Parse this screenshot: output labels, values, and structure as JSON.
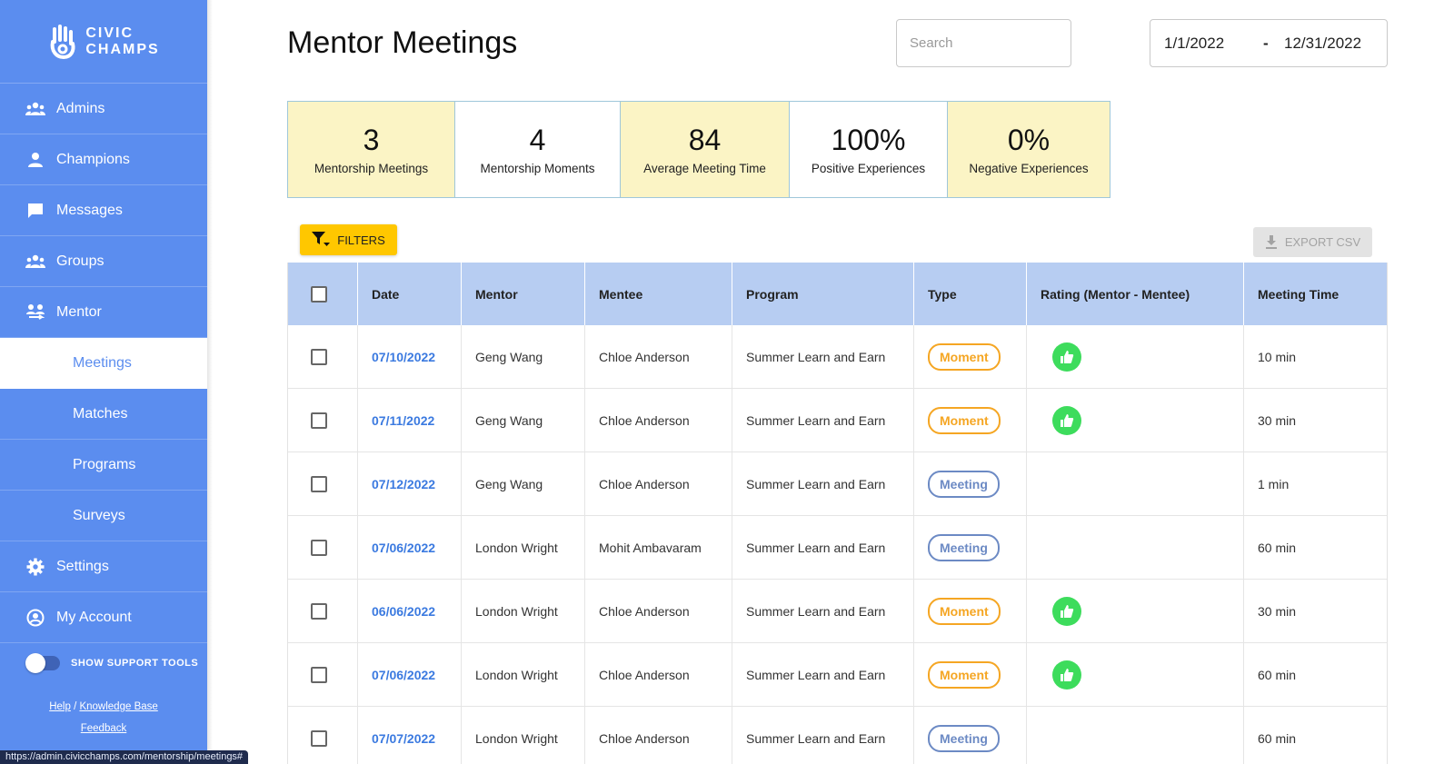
{
  "brand": {
    "line1": "CIVIC",
    "line2": "CHAMPS"
  },
  "sidebar": {
    "items": [
      {
        "label": "Admins",
        "icon": "group-icon"
      },
      {
        "label": "Champions",
        "icon": "person-icon"
      },
      {
        "label": "Messages",
        "icon": "chat-icon"
      },
      {
        "label": "Groups",
        "icon": "group-icon"
      },
      {
        "label": "Mentor",
        "icon": "mentor-icon"
      }
    ],
    "sub_items": [
      {
        "label": "Meetings",
        "active": true
      },
      {
        "label": "Matches"
      },
      {
        "label": "Programs"
      },
      {
        "label": "Surveys"
      }
    ],
    "bottom_items": [
      {
        "label": "Settings",
        "icon": "gear-icon"
      },
      {
        "label": "My Account",
        "icon": "account-icon"
      }
    ],
    "support_label": "SHOW SUPPORT TOOLS",
    "help_label": "Help",
    "slash": "/",
    "kb_label": "Knowledge Base",
    "feedback_label": "Feedback"
  },
  "status_url": "https://admin.civicchamps.com/mentorship/meetings#",
  "header": {
    "title": "Mentor Meetings",
    "search_placeholder": "Search",
    "date_start": "1/1/2022",
    "date_sep": "-",
    "date_end": "12/31/2022"
  },
  "stats": [
    {
      "value": "3",
      "label": "Mentorship Meetings"
    },
    {
      "value": "4",
      "label": "Mentorship Moments"
    },
    {
      "value": "84",
      "label": "Average Meeting Time"
    },
    {
      "value": "100%",
      "label": "Positive Experiences"
    },
    {
      "value": "0%",
      "label": "Negative Experiences"
    }
  ],
  "toolbar": {
    "filters_label": "FILTERS",
    "export_label": "EXPORT CSV"
  },
  "table": {
    "columns": [
      "Date",
      "Mentor",
      "Mentee",
      "Program",
      "Type",
      "Rating (Mentor - Mentee)",
      "Meeting Time"
    ],
    "rows": [
      {
        "date": "07/10/2022",
        "mentor": "Geng Wang",
        "mentee": "Chloe Anderson",
        "program": "Summer Learn and Earn",
        "type": "Moment",
        "rating": "thumbs-up",
        "time": "10 min"
      },
      {
        "date": "07/11/2022",
        "mentor": "Geng Wang",
        "mentee": "Chloe Anderson",
        "program": "Summer Learn and Earn",
        "type": "Moment",
        "rating": "thumbs-up",
        "time": "30 min"
      },
      {
        "date": "07/12/2022",
        "mentor": "Geng Wang",
        "mentee": "Chloe Anderson",
        "program": "Summer Learn and Earn",
        "type": "Meeting",
        "rating": "",
        "time": "1 min"
      },
      {
        "date": "07/06/2022",
        "mentor": "London Wright",
        "mentee": "Mohit Ambavaram",
        "program": "Summer Learn and Earn",
        "type": "Meeting",
        "rating": "",
        "time": "60 min"
      },
      {
        "date": "06/06/2022",
        "mentor": "London Wright",
        "mentee": "Chloe Anderson",
        "program": "Summer Learn and Earn",
        "type": "Moment",
        "rating": "thumbs-up",
        "time": "30 min"
      },
      {
        "date": "07/06/2022",
        "mentor": "London Wright",
        "mentee": "Chloe Anderson",
        "program": "Summer Learn and Earn",
        "type": "Moment",
        "rating": "thumbs-up",
        "time": "60 min"
      },
      {
        "date": "07/07/2022",
        "mentor": "London Wright",
        "mentee": "Chloe Anderson",
        "program": "Summer Learn and Earn",
        "type": "Meeting",
        "rating": "",
        "time": "60 min"
      }
    ]
  },
  "colors": {
    "sidebar": "#5b8def",
    "accent_yellow": "#ffc700",
    "moment": "#f5a623",
    "meeting": "#6c8ac4",
    "thumbs_up": "#3ddc5c",
    "table_header": "#b7cdf2"
  }
}
